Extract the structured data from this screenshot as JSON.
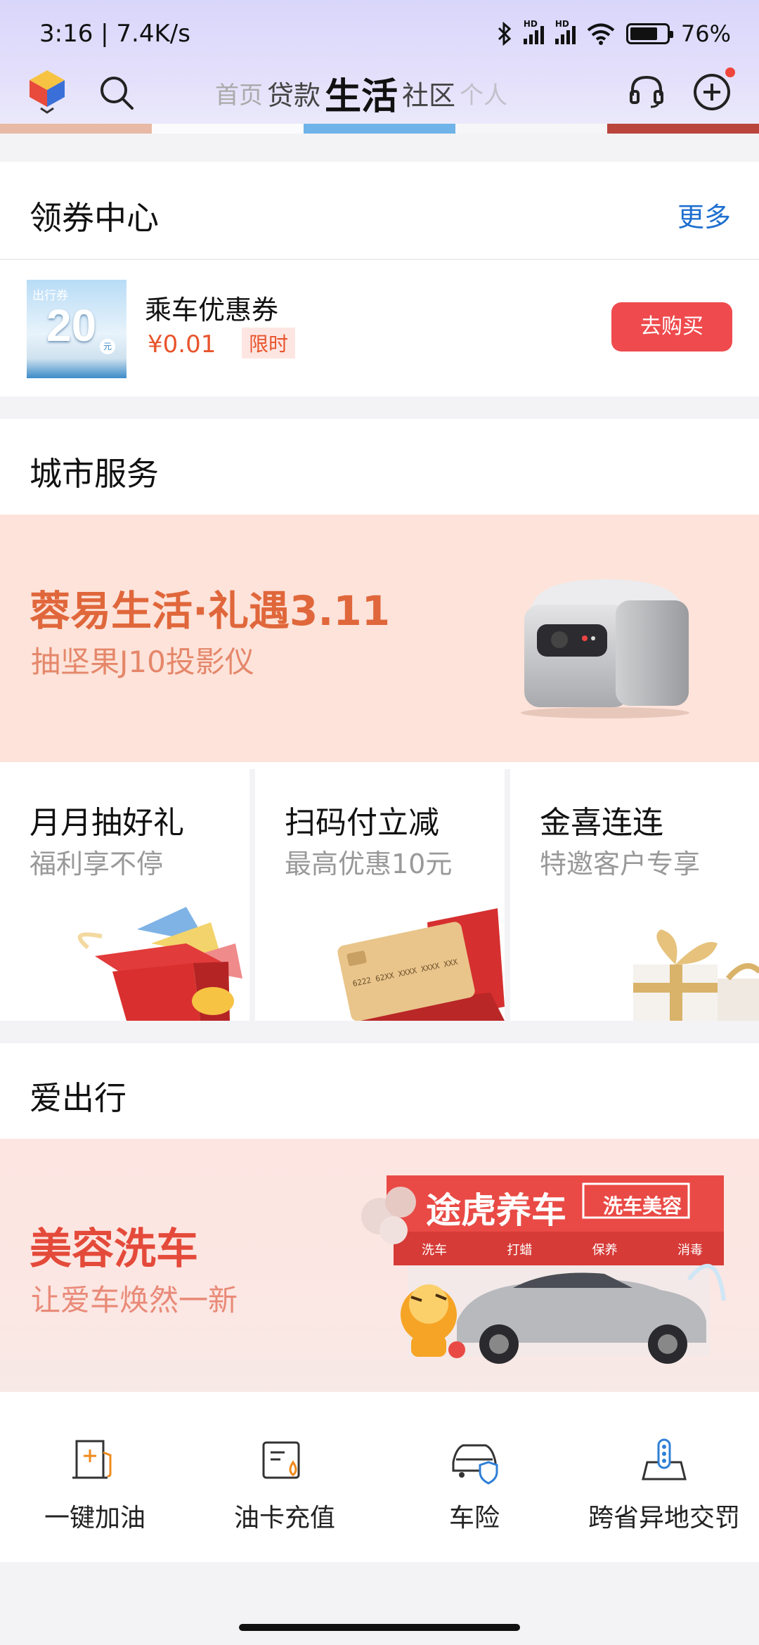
{
  "status_bar": {
    "time_speed": "3:16 | 7.4K/s",
    "network_label_1": "HD",
    "network_label_2": "HD",
    "battery": "76%",
    "battery_level": 0.76
  },
  "nav": {
    "tabs": [
      "首页",
      "贷款",
      "生活",
      "社区",
      "个人"
    ],
    "active_tab": "生活"
  },
  "coupon_center": {
    "title": "领券中心",
    "more_label": "更多",
    "coupon": {
      "thumb_tag": "出行券",
      "thumb_value": "20",
      "thumb_unit": "元",
      "name": "乘车优惠券",
      "price": "¥0.01",
      "limit_tag": "限时",
      "buy_label": "去购买"
    }
  },
  "city_services": {
    "title": "城市服务",
    "banner": {
      "title": "蓉易生活·礼遇3.11",
      "subtitle": "抽坚果J10投影仪"
    },
    "promos": [
      {
        "title": "月月抽好礼",
        "subtitle": "福利享不停"
      },
      {
        "title": "扫码付立减",
        "subtitle": "最高优惠10元"
      },
      {
        "title": "金喜连连",
        "subtitle": "特邀客户专享"
      }
    ],
    "card_art_text": "6222 62XX XXXX XXXX XXX"
  },
  "travel": {
    "title": "爱出行",
    "banner": {
      "title": "美容洗车",
      "subtitle": "让爱车焕然一新",
      "shop_name": "途虎养车",
      "shop_tag": "洗车美容",
      "shop_items": [
        "洗车",
        "打蜡",
        "保养",
        "消毒"
      ]
    },
    "services": [
      {
        "label": "一键加油",
        "icon": "fuel-icon"
      },
      {
        "label": "油卡充值",
        "icon": "fuel-card-icon"
      },
      {
        "label": "车险",
        "icon": "car-insurance-icon"
      },
      {
        "label": "跨省异地交罚",
        "icon": "traffic-fine-icon"
      }
    ]
  },
  "colors": {
    "accent_blue": "#1f6fd0",
    "price_orange": "#e8542c",
    "buy_red": "#ef4a4d",
    "banner_title_orange": "#e0673b"
  }
}
